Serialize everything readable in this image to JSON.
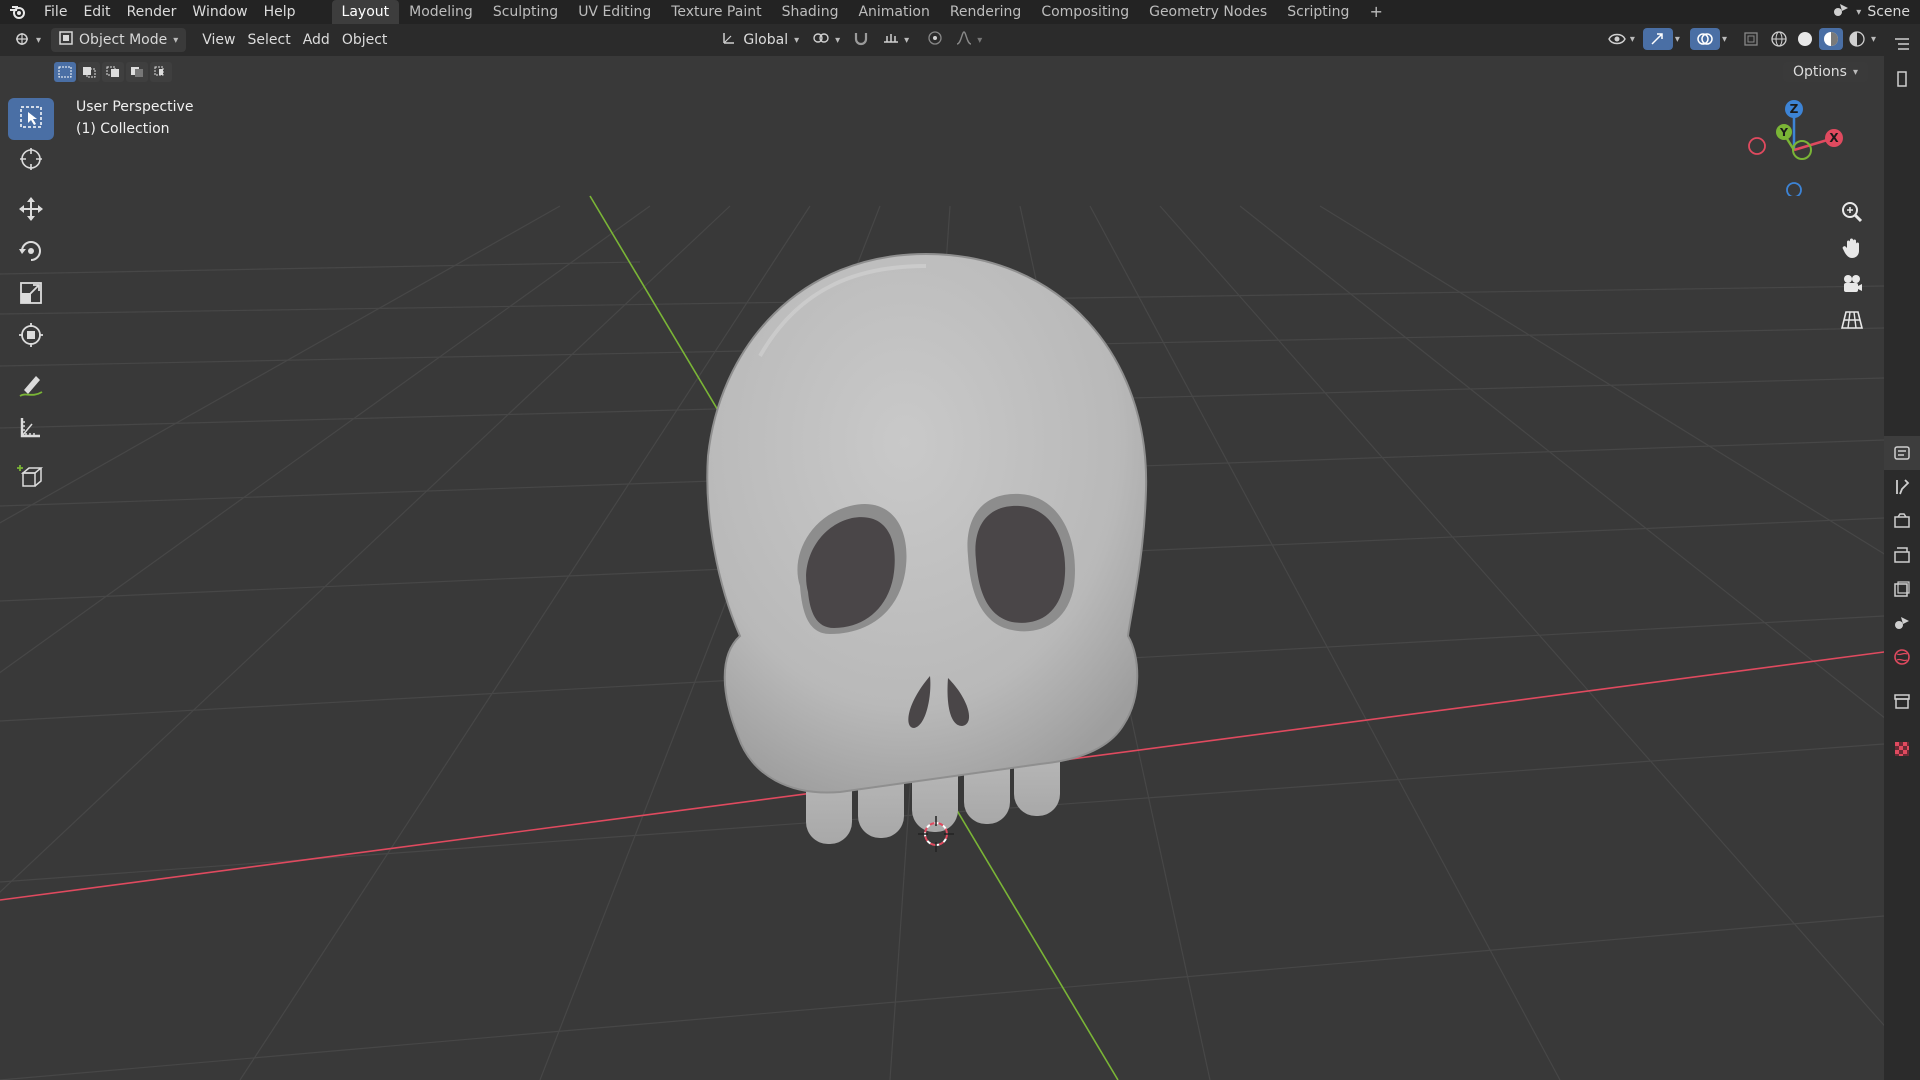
{
  "app": {
    "menus": [
      "File",
      "Edit",
      "Render",
      "Window",
      "Help"
    ],
    "workspaces": [
      "Layout",
      "Modeling",
      "Sculpting",
      "UV Editing",
      "Texture Paint",
      "Shading",
      "Animation",
      "Rendering",
      "Compositing",
      "Geometry Nodes",
      "Scripting"
    ],
    "active_workspace": "Layout",
    "add_workspace": "+",
    "scene_name": "Scene"
  },
  "header": {
    "mode": "Object Mode",
    "menus": [
      "View",
      "Select",
      "Add",
      "Object"
    ],
    "transform_orientation": "Global"
  },
  "viewport": {
    "perspective_label": "User Perspective",
    "collection_label": "(1) Collection",
    "options_label": "Options",
    "gizmo_axes": {
      "x": "X",
      "y": "Y",
      "z": "Z"
    },
    "colors": {
      "x_axis": "#e04a5f",
      "y_axis": "#7ab536",
      "z_axis": "#3d84d6",
      "active_tool": "#4a6fa5"
    }
  },
  "toolbar": {
    "tools": [
      "select-box-icon",
      "cursor-icon",
      "move-icon",
      "rotate-icon",
      "scale-icon",
      "transform-icon",
      "annotate-icon",
      "measure-icon",
      "add-cube-icon"
    ],
    "active_tool": "select-box-icon"
  }
}
